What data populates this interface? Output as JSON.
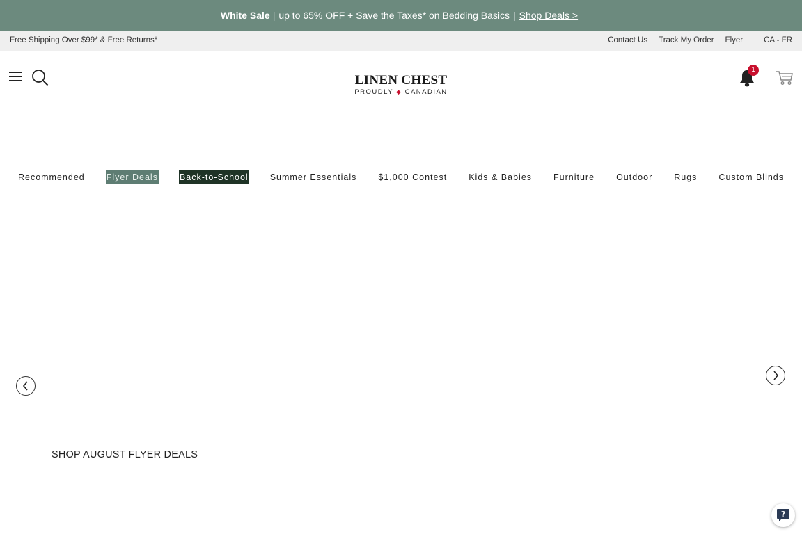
{
  "promo": {
    "strong": "White Sale",
    "text": "up to 65% OFF + Save the Taxes* on Bedding Basics",
    "separator": "|",
    "link": "Shop Deals >"
  },
  "utility": {
    "shipping": "Free Shipping Over $99* & Free Returns*",
    "links": [
      "Contact Us",
      "Track My Order",
      "Flyer"
    ],
    "language": "CA - FR"
  },
  "logo": {
    "wordmark": "LINEN CHEST",
    "tagline_left": "PROUDLY",
    "tagline_right": "CANADIAN"
  },
  "header": {
    "notification_count": "1",
    "icons": [
      "menu-icon",
      "search-icon",
      "bell-icon",
      "cart-icon"
    ]
  },
  "categories": [
    "Recommended",
    "Flyer Deals",
    "Back-to-School",
    "Summer Essentials",
    "$1,000 Contest",
    "Kids & Babies",
    "Furniture",
    "Outdoor",
    "Rugs",
    "Custom Blinds"
  ],
  "main": {
    "section_title": "SHOP AUGUST FLYER DEALS"
  },
  "colors": {
    "promo_bg": "#6c8a7e",
    "flyer_deals_bg": "#5e7d73",
    "back_to_school_bg": "#1f3326",
    "badge_red": "#c8102e"
  }
}
